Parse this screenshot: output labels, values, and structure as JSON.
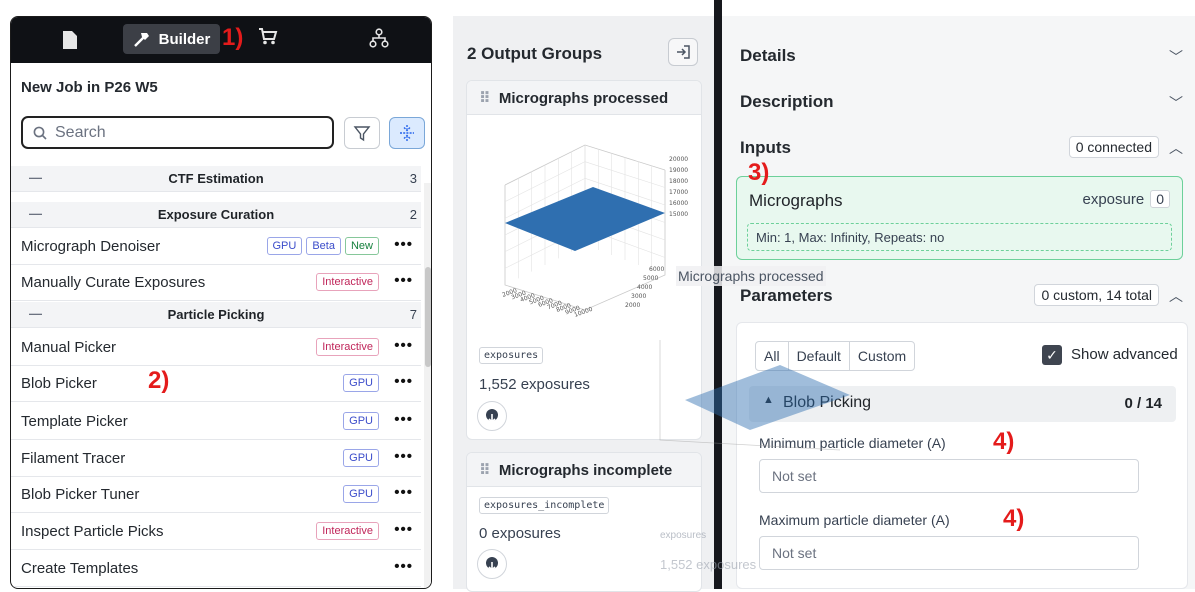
{
  "annotations": [
    "1)",
    "2)",
    "3)",
    "4)",
    "4)"
  ],
  "left": {
    "builder_label": "Builder",
    "job_title": "New Job in P26 W5",
    "search_placeholder": "Search",
    "categories": [
      {
        "name": "CTF Estimation",
        "count": "3",
        "collapse": "—"
      },
      {
        "name": "Exposure Curation",
        "count": "2",
        "collapse": "—"
      },
      {
        "name": "Particle Picking",
        "count": "7",
        "collapse": "—"
      }
    ],
    "jobs": [
      {
        "name": "Micrograph Denoiser",
        "badges": [
          "GPU",
          "Beta",
          "New"
        ]
      },
      {
        "name": "Manually Curate Exposures",
        "badges": [
          "Interactive"
        ]
      },
      {
        "name": "Manual Picker",
        "badges": [
          "Interactive"
        ]
      },
      {
        "name": "Blob Picker",
        "badges": [
          "GPU"
        ]
      },
      {
        "name": "Template Picker",
        "badges": [
          "GPU"
        ]
      },
      {
        "name": "Filament Tracer",
        "badges": [
          "GPU"
        ]
      },
      {
        "name": "Blob Picker Tuner",
        "badges": [
          "GPU"
        ]
      },
      {
        "name": "Inspect Particle Picks",
        "badges": [
          "Interactive"
        ]
      },
      {
        "name": "Create Templates",
        "badges": []
      }
    ],
    "menu_glyph": "•••"
  },
  "middle": {
    "title": "2 Output Groups",
    "groups": [
      {
        "name": "Micrographs processed",
        "chip": "exposures",
        "count": "1,552 exposures"
      },
      {
        "name": "Micrographs incomplete",
        "chip": "exposures_incomplete",
        "count": "0 exposures"
      }
    ],
    "chart_ticks": {
      "z": [
        "20000",
        "19000",
        "18000",
        "17000",
        "16000",
        "15000"
      ],
      "x": [
        "2000",
        "3000",
        "4000",
        "5000",
        "6000",
        "7000",
        "8000",
        "9000",
        "10000"
      ],
      "y": [
        "2000",
        "3000",
        "4000",
        "5000",
        "6000"
      ]
    }
  },
  "right": {
    "details": "Details",
    "description": "Description",
    "inputs": "Inputs",
    "inputs_status": "0 connected",
    "micrographs": "Micrographs",
    "micrographs_type": "exposure",
    "micrographs_count": "0",
    "micrographs_constraint": "Min: 1, Max: Infinity, Repeats: no",
    "parameters": "Parameters",
    "parameters_status": "0 custom, 14 total",
    "tabs": [
      "All",
      "Default",
      "Custom"
    ],
    "show_advanced": "Show advanced",
    "blob_section": "Blob Picking",
    "blob_count": "0 / 14",
    "min_label": "Minimum particle diameter (A)",
    "min_value": "Not set",
    "max_label": "Maximum particle diameter (A)",
    "max_value": "Not set"
  },
  "drag_ghost": {
    "label": "Micrographs processed",
    "chip": "exposures",
    "count": "1,552 exposures"
  },
  "colors": {
    "accent_blue": "#2f6fb0",
    "input_green": "#e8f8ef",
    "annotation_red": "#e41b1b"
  }
}
